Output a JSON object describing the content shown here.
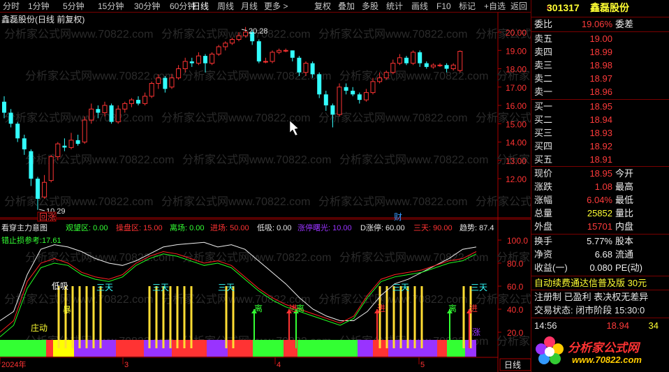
{
  "toolbar": {
    "periods": [
      "分时",
      "1分钟",
      "5分钟",
      "15分钟",
      "30分钟",
      "60分钟",
      "日线",
      "周线",
      "月线",
      "更多 >"
    ],
    "active_period": "日线",
    "actions": [
      "复权",
      "叠加",
      "多股",
      "统计",
      "画线",
      "F10",
      "标记",
      "+自选",
      "返回"
    ]
  },
  "main_chart": {
    "title": "鑫磊股份(日线 前复权)",
    "price_ticks": [
      "20.00",
      "19.00",
      "18.00",
      "17.00",
      "16.00",
      "15.00",
      "14.00",
      "13.00",
      "12.00"
    ],
    "high_label": "20.28",
    "low_label": "10.29",
    "marker_left": "回涨",
    "marker_mid": "财",
    "colors": {
      "up": "#ff3333",
      "down": "#33ffff",
      "bg": "#000000",
      "axis": "#aa0000"
    }
  },
  "indicator": {
    "name": "看穿主力意图",
    "params": [
      {
        "label": "观望区: 0.00",
        "color": "#33ff33"
      },
      {
        "label": "操盘区: 15.00",
        "color": "#ff3333"
      },
      {
        "label": "离场: 0.00",
        "color": "#33ff33"
      },
      {
        "label": "进场: 50.00",
        "color": "#ff3333"
      },
      {
        "label": "低吸: 0.00",
        "color": "#e6e6e6"
      },
      {
        "label": "涨停曙光: 10.00",
        "color": "#9933ff"
      },
      {
        "label": "D涨停: 60.00",
        "color": "#e6e6e6"
      },
      {
        "label": "三天: 90.00",
        "color": "#ff3333"
      },
      {
        "label": "趋势: 87.4",
        "color": "#e6e6e6"
      }
    ],
    "stop_label": "错止损参考:17.61",
    "ticks": [
      "100.0",
      "80.0",
      "60.0",
      "40.0",
      "20.0"
    ],
    "tags": [
      {
        "text": "低吸",
        "color": "#ffffff"
      },
      {
        "text": "三天",
        "color": "#33ffff"
      },
      {
        "text": "三天",
        "color": "#33ffff"
      },
      {
        "text": "三天",
        "color": "#33ffff"
      },
      {
        "text": "三天",
        "color": "#33ffff"
      },
      {
        "text": "三天",
        "color": "#33ffff"
      },
      {
        "text": "离",
        "color": "#33ff33"
      },
      {
        "text": "进",
        "color": "#ff3333"
      },
      {
        "text": "离",
        "color": "#33ff33"
      },
      {
        "text": "进",
        "color": "#ff3333"
      },
      {
        "text": "离",
        "color": "#33ff33"
      },
      {
        "text": "进",
        "color": "#ff3333"
      },
      {
        "text": "庄动",
        "color": "#ffff33"
      },
      {
        "text": "暴",
        "color": "#ffff33"
      },
      {
        "text": "涨",
        "color": "#9933ff"
      }
    ]
  },
  "x_axis": [
    "2024年",
    "3",
    "4",
    "5"
  ],
  "period_label": "日线",
  "quote": {
    "code": "301317",
    "name": "鑫磊股份",
    "wei_bi_label": "委比",
    "wei_bi": "19.06%",
    "wei_cha_label": "委差",
    "asks": [
      {
        "label": "卖五",
        "price": "19.00"
      },
      {
        "label": "卖四",
        "price": "18.99"
      },
      {
        "label": "卖三",
        "price": "18.98"
      },
      {
        "label": "卖二",
        "price": "18.97"
      },
      {
        "label": "卖一",
        "price": "18.96"
      }
    ],
    "bids": [
      {
        "label": "买一",
        "price": "18.95"
      },
      {
        "label": "买二",
        "price": "18.94"
      },
      {
        "label": "买三",
        "price": "18.93"
      },
      {
        "label": "买四",
        "price": "18.92"
      },
      {
        "label": "买五",
        "price": "18.91"
      }
    ],
    "stats": [
      {
        "l1": "现价",
        "v1": "18.95",
        "c1": "#ff3b3b",
        "l2": "今开"
      },
      {
        "l1": "涨跌",
        "v1": "1.08",
        "c1": "#ff3b3b",
        "l2": "最高"
      },
      {
        "l1": "涨幅",
        "v1": "6.04%",
        "c1": "#ff3b3b",
        "l2": "最低"
      },
      {
        "l1": "总量",
        "v1": "25852",
        "c1": "#ffff33",
        "l2": "量比"
      },
      {
        "l1": "外盘",
        "v1": "15701",
        "c1": "#ff3b3b",
        "l2": "内盘"
      }
    ],
    "stats2": [
      {
        "l1": "换手",
        "v1": "5.77%",
        "c1": "#f0f0f0",
        "l2": "股本"
      },
      {
        "l1": "净资",
        "v1": "6.68",
        "c1": "#f0f0f0",
        "l2": "流通"
      },
      {
        "l1": "收益(一)",
        "v1": "0.080",
        "c1": "#f0f0f0",
        "l2": "PE(动)"
      }
    ],
    "ticker": "自动续费通达信普及版 30元",
    "info": "注册制 已盈利 表决权无差异",
    "status": "交易状态: 闭市阶段 15:30:0",
    "last_trade": {
      "time": "14:56",
      "price": "18.94",
      "vol": "34"
    }
  },
  "logo": {
    "text": "分析家公式网",
    "url": "www.70822.com"
  },
  "watermark": "分析家公式网www.70822.com"
}
